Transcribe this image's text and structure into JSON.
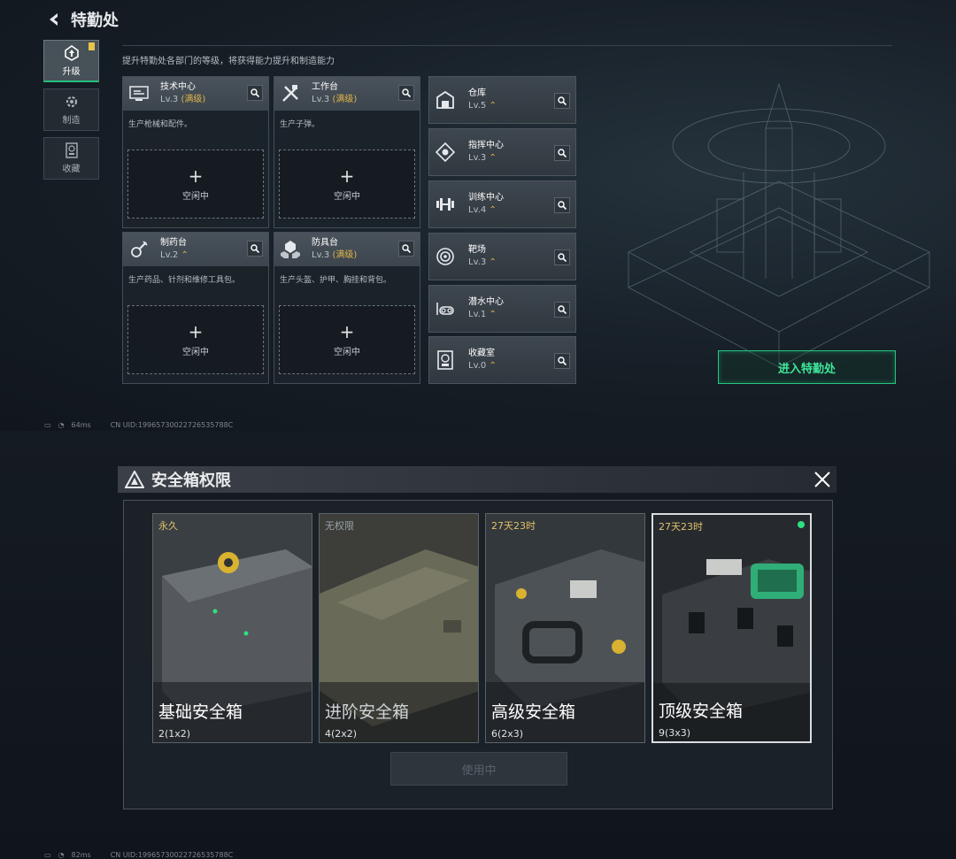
{
  "top": {
    "title": "特勤处",
    "subtitle": "提升特勤处各部门的等级，将获得能力提升和制造能力",
    "nav": [
      {
        "label": "升级",
        "icon": "upgrade-icon"
      },
      {
        "label": "制造",
        "icon": "gear-icon"
      },
      {
        "label": "收藏",
        "icon": "collection-icon"
      }
    ],
    "workstations": [
      {
        "name": "技术中心",
        "level": "Lv.3",
        "max": "(满级)",
        "desc": "生产枪械和配件。",
        "slot": "空闲中",
        "icon": "tech-center-icon"
      },
      {
        "name": "工作台",
        "level": "Lv.3",
        "max": "(满级)",
        "desc": "生产子弹。",
        "slot": "空闲中",
        "icon": "workbench-icon"
      },
      {
        "name": "制药台",
        "level": "Lv.2",
        "max": "",
        "desc": "生产药品、针剂和维修工具包。",
        "slot": "空闲中",
        "icon": "pharmacy-icon"
      },
      {
        "name": "防具台",
        "level": "Lv.3",
        "max": "(满级)",
        "desc": "生产头盔、护甲、胸挂和背包。",
        "slot": "空闲中",
        "icon": "armor-bench-icon"
      }
    ],
    "rooms": [
      {
        "name": "仓库",
        "level": "Lv.5",
        "icon": "warehouse-icon"
      },
      {
        "name": "指挥中心",
        "level": "Lv.3",
        "icon": "command-center-icon"
      },
      {
        "name": "训练中心",
        "level": "Lv.4",
        "icon": "training-center-icon"
      },
      {
        "name": "靶场",
        "level": "Lv.3",
        "icon": "shooting-range-icon"
      },
      {
        "name": "潜水中心",
        "level": "Lv.1",
        "icon": "diving-center-icon"
      },
      {
        "name": "收藏室",
        "level": "Lv.0",
        "icon": "collection-room-icon"
      }
    ],
    "enter_label": "进入特勤处",
    "status": {
      "ping": "64ms",
      "uid": "CN UID:19965730022726535788C"
    }
  },
  "bottom": {
    "title": "安全箱权限",
    "cases": [
      {
        "tag": "永久",
        "name": "基础安全箱",
        "size": "2(1x2)",
        "color": "#4a4f53"
      },
      {
        "tag": "无权限",
        "name": "进阶安全箱",
        "size": "4(2x2)",
        "color": "#5b5a4c"
      },
      {
        "tag": "27天23时",
        "name": "高级安全箱",
        "size": "6(2x3)",
        "color": "#3f4449"
      },
      {
        "tag": "27天23时",
        "name": "顶级安全箱",
        "size": "9(3x3)",
        "color": "#2d3236"
      }
    ],
    "use_label": "使用中",
    "status": {
      "ping": "82ms",
      "uid": "CN UID:19965730022726535788C"
    }
  },
  "colors": {
    "accent": "#26c47f",
    "gold": "#e0b44a"
  }
}
